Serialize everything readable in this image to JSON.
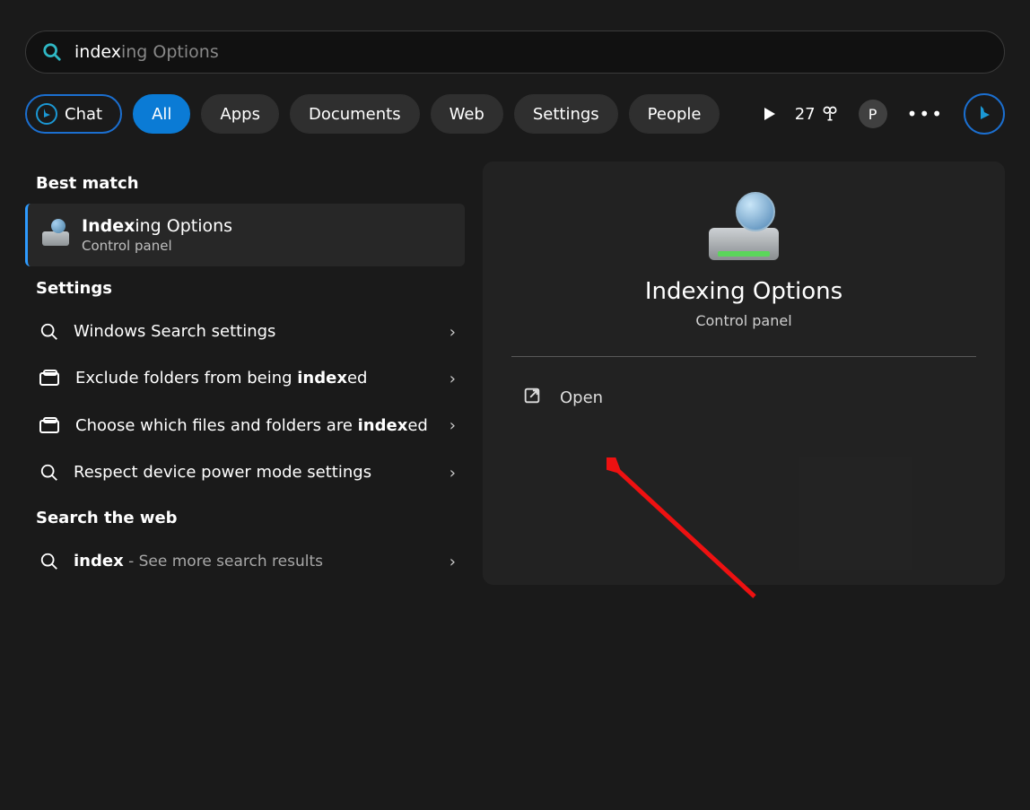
{
  "search": {
    "typed": "index",
    "completion": "ing Options"
  },
  "filters": {
    "chat": "Chat",
    "all": "All",
    "apps": "Apps",
    "documents": "Documents",
    "web": "Web",
    "settings": "Settings",
    "people": "People"
  },
  "topRight": {
    "score": "27",
    "avatar": "P"
  },
  "left": {
    "bestMatchHeading": "Best match",
    "bestMatch": {
      "titleBold": "Index",
      "titleRest": "ing Options",
      "subtitle": "Control panel"
    },
    "settingsHeading": "Settings",
    "settingsItems": [
      {
        "pre": "Windows Search settings",
        "bold": "",
        "post": ""
      },
      {
        "pre": "Exclude folders from being ",
        "bold": "index",
        "post": "ed"
      },
      {
        "pre": "Choose which files and folders are ",
        "bold": "index",
        "post": "ed"
      },
      {
        "pre": "Respect device power mode settings",
        "bold": "",
        "post": ""
      }
    ],
    "webHeading": "Search the web",
    "webItem": {
      "bold": "index",
      "rest": " - See more search results"
    }
  },
  "detail": {
    "title": "Indexing Options",
    "subtitle": "Control panel",
    "open": "Open"
  }
}
